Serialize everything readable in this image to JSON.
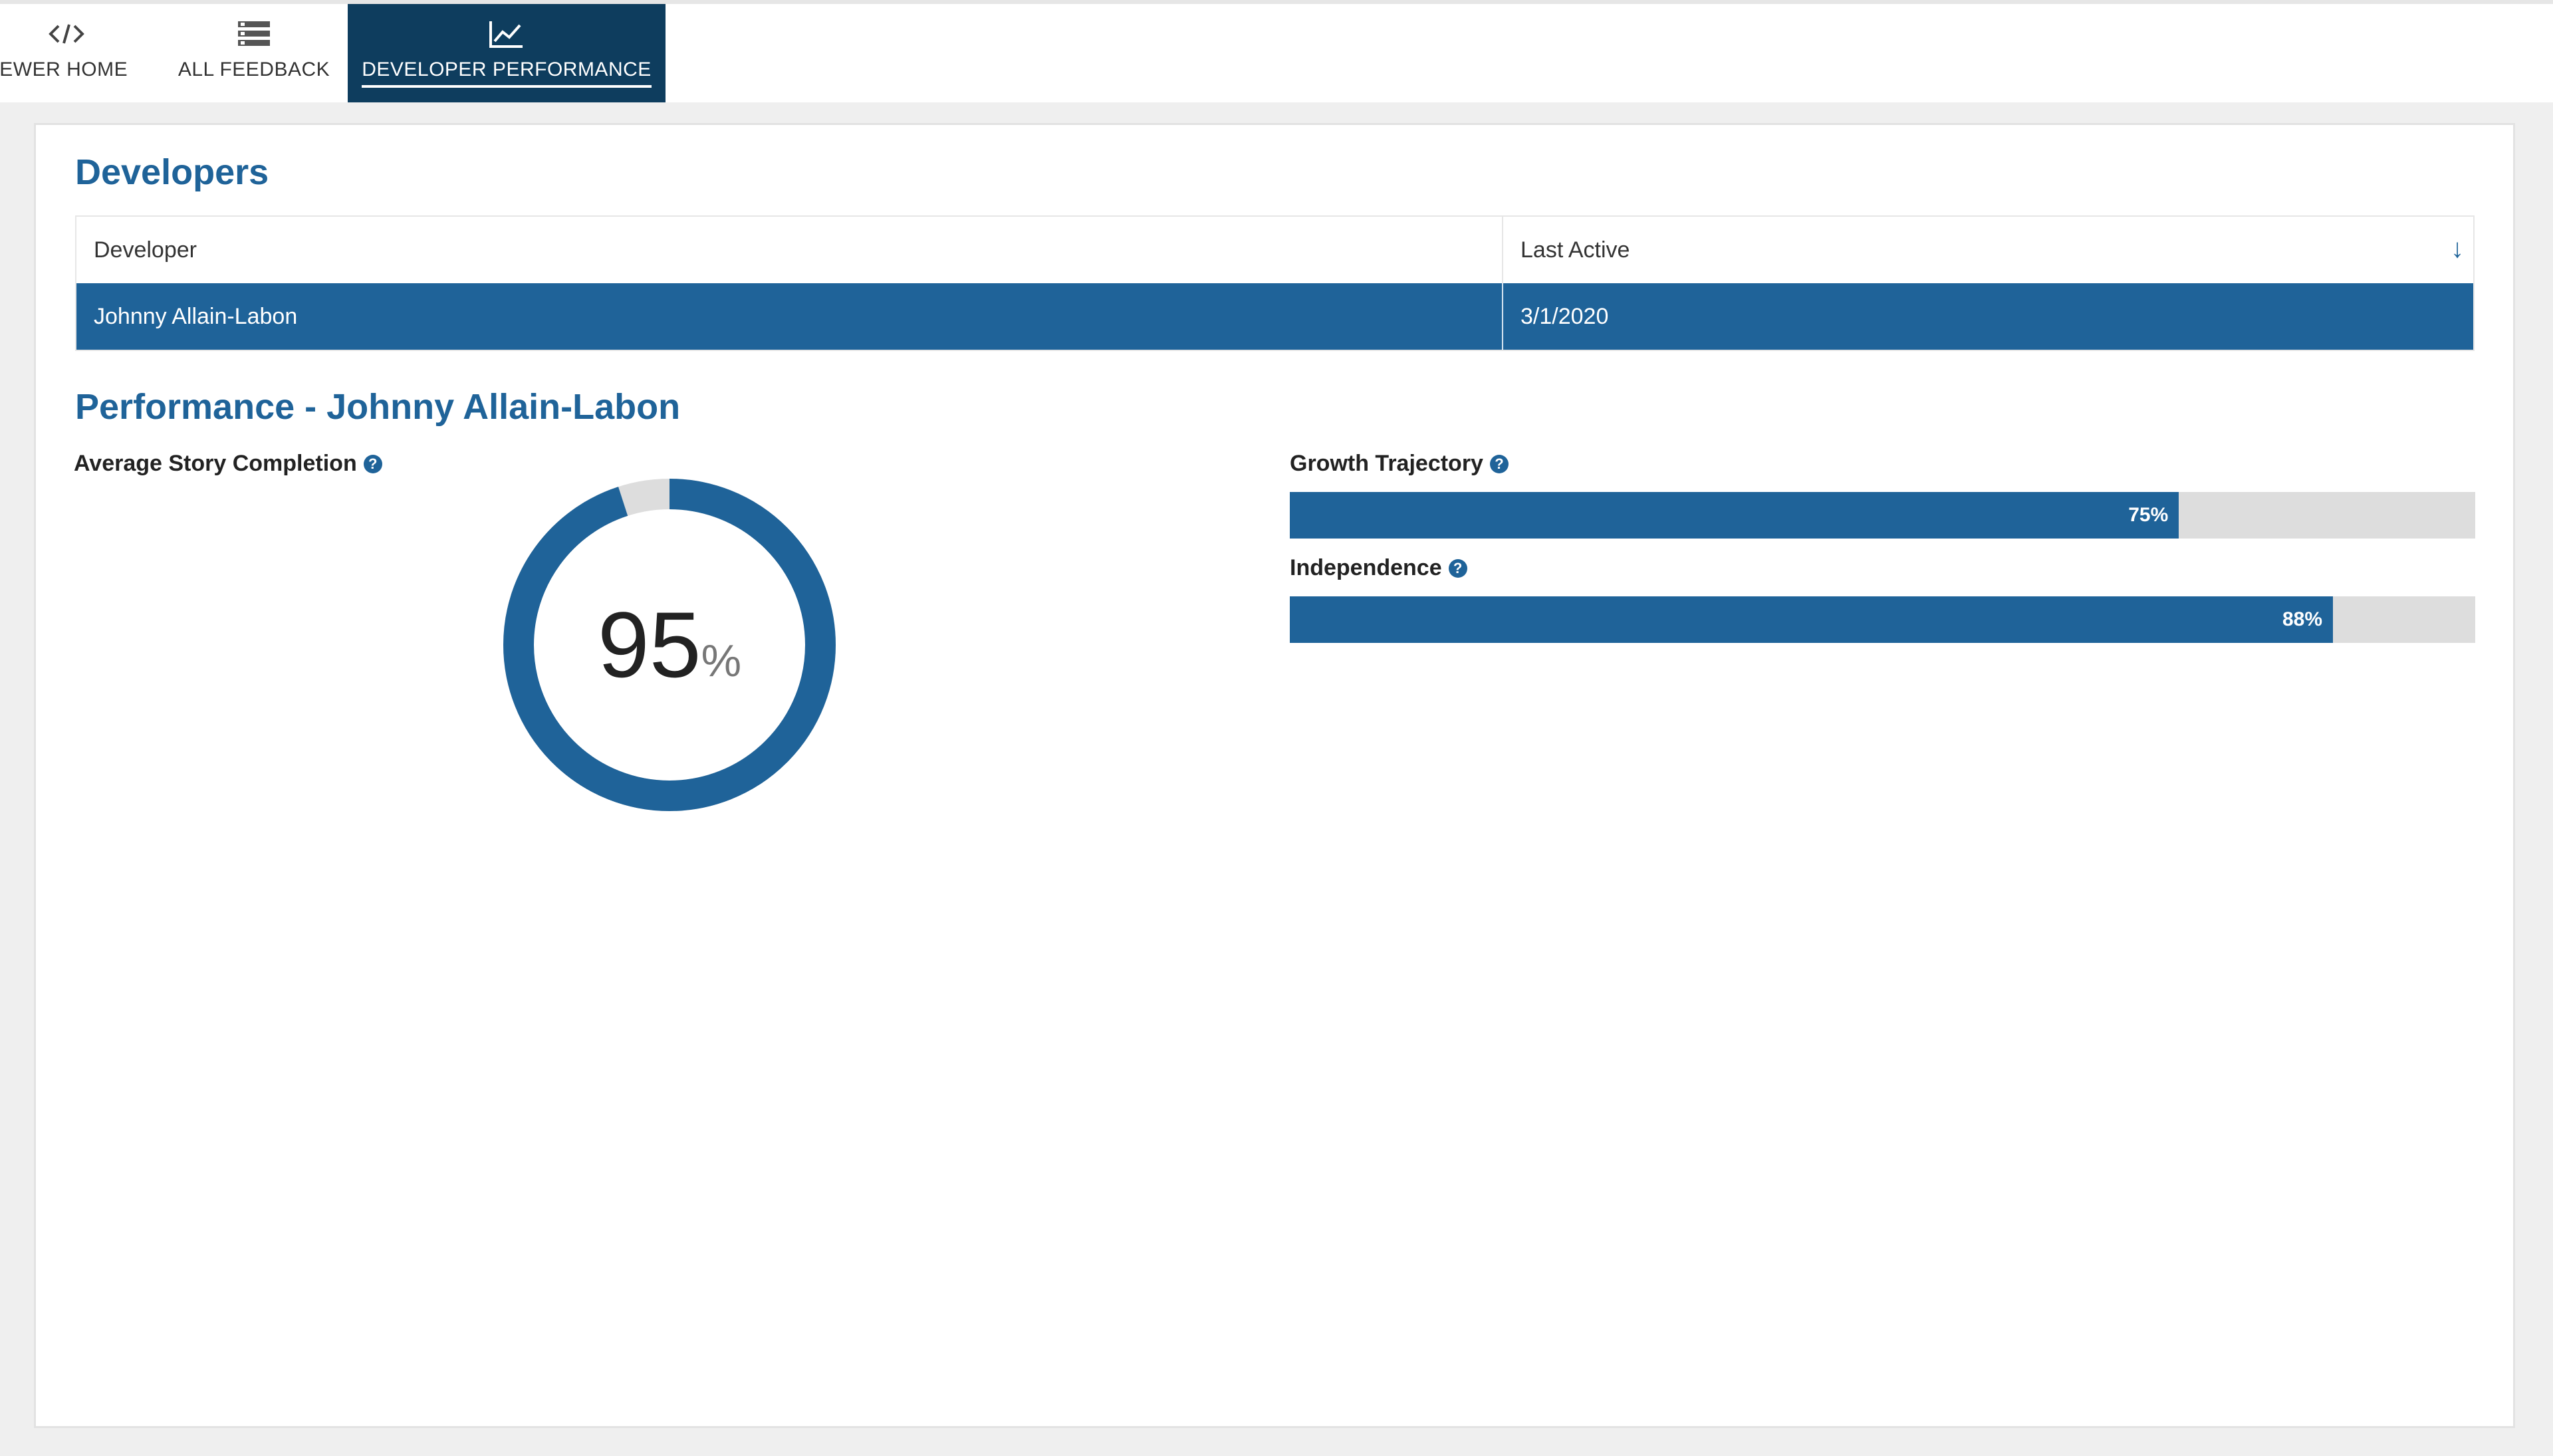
{
  "nav": {
    "tabs": [
      {
        "label": "VIEWER HOME",
        "icon": "code-icon"
      },
      {
        "label": "ALL FEEDBACK",
        "icon": "list-icon"
      },
      {
        "label": "DEVELOPER PERFORMANCE",
        "icon": "chart-line-icon",
        "active": true
      }
    ]
  },
  "developers": {
    "title": "Developers",
    "columns": [
      "Developer",
      "Last Active"
    ],
    "sort_icon": "sort-down-arrow-icon",
    "rows": [
      {
        "developer": "Johnny Allain-Labon",
        "last_active": "3/1/2020",
        "selected": true
      }
    ]
  },
  "performance": {
    "title": "Performance - Johnny Allain-Labon",
    "average_story_completion": {
      "label": "Average Story Completion",
      "value": 95,
      "value_text": "95",
      "unit": "%"
    },
    "growth_trajectory": {
      "label": "Growth Trajectory",
      "value": 75,
      "value_text": "75%"
    },
    "independence": {
      "label": "Independence",
      "value": 88,
      "value_text": "88%"
    },
    "help_icon": "question-circle-icon"
  },
  "colors": {
    "primary": "#1f6399",
    "nav_active": "#0e3d5e",
    "track": "#dddddd",
    "page_bg": "#efefef"
  }
}
